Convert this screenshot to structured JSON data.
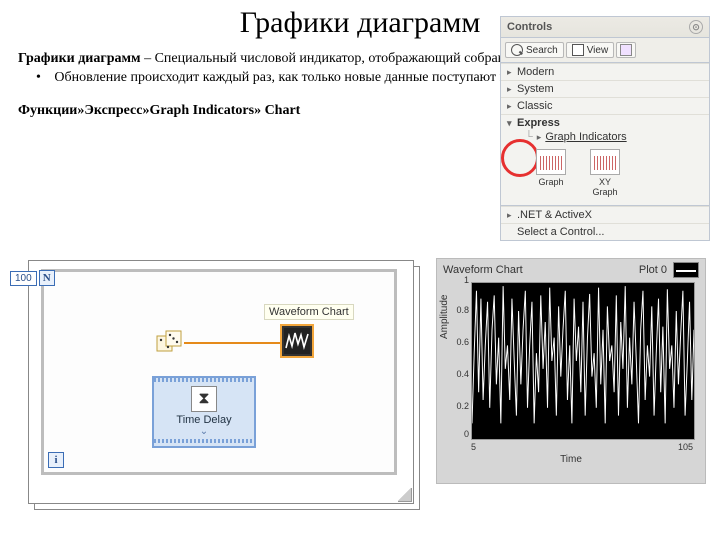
{
  "title": "Графики диаграмм",
  "intro_bold": "Графики диаграмм",
  "intro_rest": " – Специальный числовой индикатор, отображающий  собранные данные  по времени",
  "bullet_text": "  Обновление происходит каждый раз, как только новые данные поступают на терминал диаграммы",
  "fpath": "Функции»Экспресс»Graph Indicators» Chart",
  "palette": {
    "title": "Controls",
    "search": "Search",
    "view": "View",
    "rows": {
      "modern": "Modern",
      "system": "System",
      "classic": "Classic",
      "express": "Express",
      "graph_ind": "Graph Indicators",
      "net": ".NET & ActiveX",
      "select": "Select a Control..."
    },
    "thumb_graph": "Graph",
    "thumb_xy": "XY Graph"
  },
  "bd": {
    "n_value": "100",
    "n_letter": "N",
    "i_letter": "i",
    "wc_label": "Waveform Chart",
    "time_delay": "Time Delay"
  },
  "chart": {
    "title": "Waveform Chart",
    "legend": "Plot 0",
    "ylabel": "Amplitude",
    "xlabel": "Time",
    "xmin": "5",
    "xmax": "105",
    "y0": "0",
    "y1": "0.2",
    "y2": "0.4",
    "y3": "0.6",
    "y4": "0.8",
    "y5": "1"
  },
  "chart_data": {
    "type": "line",
    "title": "Waveform Chart",
    "xlabel": "Time",
    "ylabel": "Amplitude",
    "ylim": [
      0,
      1
    ],
    "xlim": [
      5,
      105
    ],
    "series": [
      {
        "name": "Plot 0",
        "x": [
          5,
          6,
          7,
          8,
          9,
          10,
          11,
          12,
          13,
          14,
          15,
          16,
          17,
          18,
          19,
          20,
          21,
          22,
          23,
          24,
          25,
          26,
          27,
          28,
          29,
          30,
          31,
          32,
          33,
          34,
          35,
          36,
          37,
          38,
          39,
          40,
          41,
          42,
          43,
          44,
          45,
          46,
          47,
          48,
          49,
          50,
          51,
          52,
          53,
          54,
          55,
          56,
          57,
          58,
          59,
          60,
          61,
          62,
          63,
          64,
          65,
          66,
          67,
          68,
          69,
          70,
          71,
          72,
          73,
          74,
          75,
          76,
          77,
          78,
          79,
          80,
          81,
          82,
          83,
          84,
          85,
          86,
          87,
          88,
          89,
          90,
          91,
          92,
          93,
          94,
          95,
          96,
          97,
          98,
          99,
          100,
          101,
          102,
          103,
          104,
          105
        ],
        "values": [
          0.1,
          0.55,
          0.95,
          0.3,
          0.9,
          0.25,
          0.6,
          0.88,
          0.2,
          0.7,
          0.92,
          0.35,
          0.65,
          0.1,
          0.98,
          0.45,
          0.6,
          0.25,
          0.9,
          0.5,
          0.15,
          0.82,
          0.35,
          0.7,
          0.95,
          0.2,
          0.6,
          0.88,
          0.1,
          0.55,
          0.3,
          0.92,
          0.45,
          0.75,
          0.2,
          0.97,
          0.5,
          0.65,
          0.15,
          0.85,
          0.4,
          0.7,
          0.95,
          0.25,
          0.6,
          0.1,
          0.9,
          0.5,
          0.72,
          0.3,
          0.88,
          0.15,
          0.65,
          0.93,
          0.4,
          0.55,
          0.2,
          0.97,
          0.35,
          0.7,
          0.1,
          0.85,
          0.5,
          0.6,
          0.3,
          0.92,
          0.15,
          0.75,
          0.45,
          0.98,
          0.2,
          0.65,
          0.35,
          0.88,
          0.5,
          0.1,
          0.7,
          0.95,
          0.25,
          0.6,
          0.4,
          0.85,
          0.15,
          0.55,
          0.9,
          0.3,
          0.72,
          0.1,
          0.96,
          0.45,
          0.6,
          0.2,
          0.82,
          0.35,
          0.68,
          0.95,
          0.15,
          0.5,
          0.88,
          0.25,
          0.7
        ]
      }
    ]
  }
}
